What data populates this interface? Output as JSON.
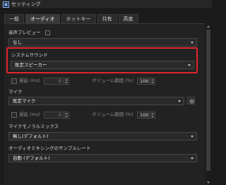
{
  "window": {
    "title": "セッティング"
  },
  "tabs": [
    {
      "label": "一般"
    },
    {
      "label": "オーディオ"
    },
    {
      "label": "ホットキー"
    },
    {
      "label": "共有"
    },
    {
      "label": "高度"
    }
  ],
  "active_tab": "オーディオ",
  "audio_preview": {
    "label": "音声プレビュー",
    "value": "なし"
  },
  "system_sound": {
    "label": "システムサウンド",
    "value": "既定スピーカー"
  },
  "system_sound_delay": {
    "label": "遅延 (ms)",
    "value": "0"
  },
  "system_sound_volume": {
    "label": "ボリューム範囲 (%)",
    "value": "100"
  },
  "mic": {
    "label": "マイク",
    "value": "既定マイク"
  },
  "mic_delay": {
    "label": "遅延 (ms)",
    "value": "0"
  },
  "mic_volume": {
    "label": "ボリューム範囲 (%)",
    "value": "100"
  },
  "mic_mono_mix": {
    "label": "マイクモノラルミックス",
    "value": "無し(デフォルト)"
  },
  "sample_rate": {
    "label": "オーディオミキシングのサンプルレート",
    "value": "自動 (デフォルト)"
  },
  "colors": {
    "highlight": "#e0262d",
    "background": "#222222",
    "accent_icon": "#7fb2ff"
  }
}
